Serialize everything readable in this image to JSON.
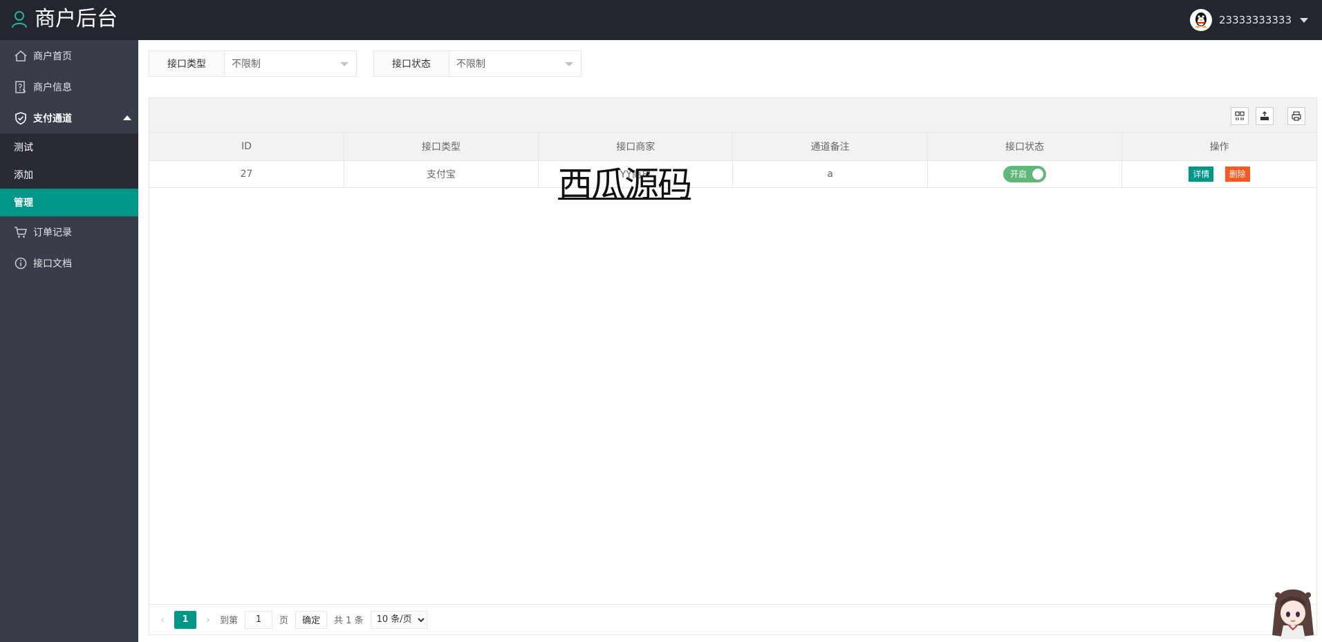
{
  "header": {
    "title": "商户后台",
    "username": "23333333333"
  },
  "sidebar": {
    "items": [
      {
        "label": "商户首页",
        "icon": "home-icon"
      },
      {
        "label": "商户信息",
        "icon": "help-doc-icon"
      },
      {
        "label": "支付通道",
        "icon": "shield-check-icon"
      },
      {
        "label": "订单记录",
        "icon": "cart-icon"
      },
      {
        "label": "接口文档",
        "icon": "info-icon"
      }
    ],
    "sub_items": [
      {
        "label": "测试"
      },
      {
        "label": "添加"
      },
      {
        "label": "管理"
      }
    ]
  },
  "filters": {
    "type_label": "接口类型",
    "type_value": "不限制",
    "status_label": "接口状态",
    "status_value": "不限制"
  },
  "toolbar": {
    "icons": [
      "columns-icon",
      "export-icon",
      "print-icon"
    ]
  },
  "table": {
    "headers": [
      "ID",
      "接口类型",
      "接口商家",
      "通道备注",
      "接口状态",
      "操作"
    ],
    "rows": [
      {
        "id": "27",
        "type": "支付宝",
        "merchant": "YY商户",
        "remark": "a",
        "status": "开启",
        "detail": "详情",
        "delete": "删除"
      }
    ],
    "watermark": "西瓜源码"
  },
  "pager": {
    "current": "1",
    "goto_label": "到第",
    "goto_value": "1",
    "page_label": "页",
    "confirm": "确定",
    "total": "共 1 条",
    "per_page": "10 条/页"
  },
  "colors": {
    "topbar": "#23262e",
    "sidebar": "#393d49",
    "accent": "#009688",
    "switch_on": "#5fb878",
    "danger": "#ff5722"
  }
}
